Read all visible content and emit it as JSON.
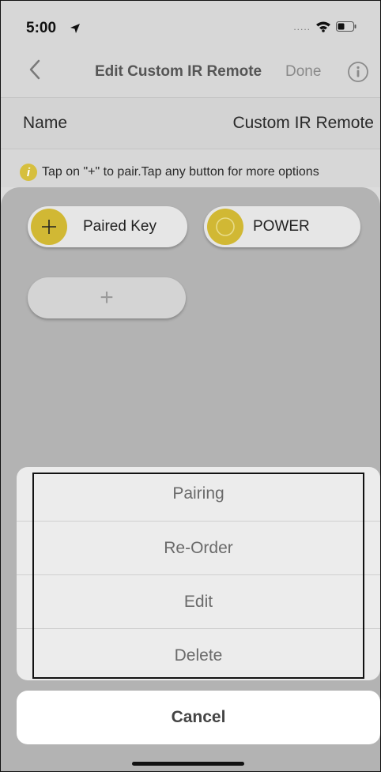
{
  "status_bar": {
    "time": "5:00",
    "signal": "....."
  },
  "nav": {
    "title": "Edit Custom IR Remote",
    "done_label": "Done"
  },
  "name_row": {
    "label": "Name",
    "value": "Custom IR Remote"
  },
  "hint": {
    "icon_text": "i",
    "text": "Tap on \"+\" to pair.Tap any button for more options"
  },
  "keys": [
    {
      "label": "Paired Key",
      "icon": "plus-icon"
    },
    {
      "label": "POWER",
      "icon": "ring-icon"
    }
  ],
  "add_key": {
    "label": "+"
  },
  "action_sheet": {
    "items": [
      {
        "label": "Pairing"
      },
      {
        "label": "Re-Order"
      },
      {
        "label": "Edit"
      },
      {
        "label": "Delete"
      }
    ],
    "cancel_label": "Cancel"
  },
  "colors": {
    "accent_yellow": "#d1b834",
    "overlay_gray": "#b3b3b3",
    "sheet_bg": "#ececec"
  }
}
